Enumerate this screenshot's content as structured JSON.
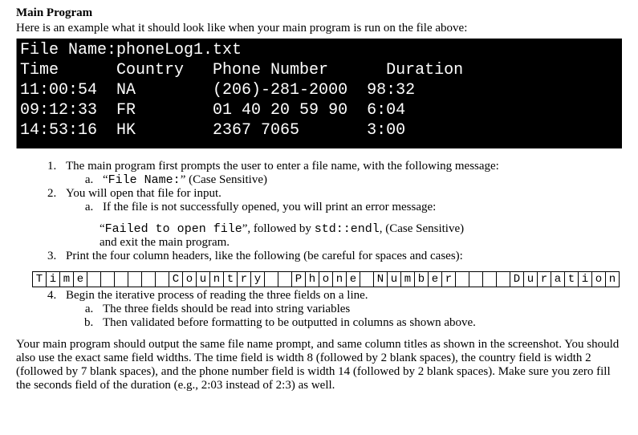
{
  "heading": "Main Program",
  "intro": "Here is an example what it should look like when your main program is run on the file above:",
  "terminal": {
    "line1": "File Name:phoneLog1.txt",
    "line2": "Time      Country   Phone Number      Duration",
    "line3": "11:00:54  NA        (206)-281-2000  98:32",
    "line4": "09:12:33  FR        01 40 20 59 90  6:04",
    "line5": "14:53:16  HK        2367 7065       3:00"
  },
  "list": {
    "item1": "The main program first prompts the user to enter a file name, with the following message:",
    "item1a_pre": "“",
    "item1a_code": "File Name:",
    "item1a_post": "” (Case Sensitive)",
    "item2": "You will open that file for input.",
    "item2a": "If the file is not successfully opened, you will print an error message:",
    "item2a_line2_pre": "“",
    "item2a_line2_code1": "Failed to open file",
    "item2a_line2_mid": "”, followed by ",
    "item2a_line2_code2": "std::endl",
    "item2a_line2_post": ", (Case Sensitive)",
    "item2a_line3": "and exit the main program.",
    "item3": "Print the four column headers, like the following (be careful for spaces and cases):",
    "item4": "Begin the iterative process of reading the three fields on a line.",
    "item4a": "The three fields should be read into string variables",
    "item4b": "Then validated before formatting to be outputted in columns as shown above."
  },
  "grid_cells": [
    "T",
    "i",
    "m",
    "e",
    "",
    "",
    "",
    "",
    "",
    "",
    "C",
    "o",
    "u",
    "n",
    "t",
    "r",
    "y",
    "",
    "",
    "P",
    "h",
    "o",
    "n",
    "e",
    "",
    "N",
    "u",
    "m",
    "b",
    "e",
    "r",
    "",
    "",
    "",
    "",
    "D",
    "u",
    "r",
    "a",
    "t",
    "i",
    "o",
    "n"
  ],
  "closing": "Your main program should output the same file name prompt, and same column titles as shown in the screenshot.  You should also use the exact same field widths. The time field is width 8 (followed by 2 blank spaces), the country field is width 2 (followed by 7 blank spaces), and the phone number field is width 14 (followed by 2 blank spaces).  Make sure you zero fill the seconds field of the duration (e.g., 2:03 instead of 2:3) as well."
}
